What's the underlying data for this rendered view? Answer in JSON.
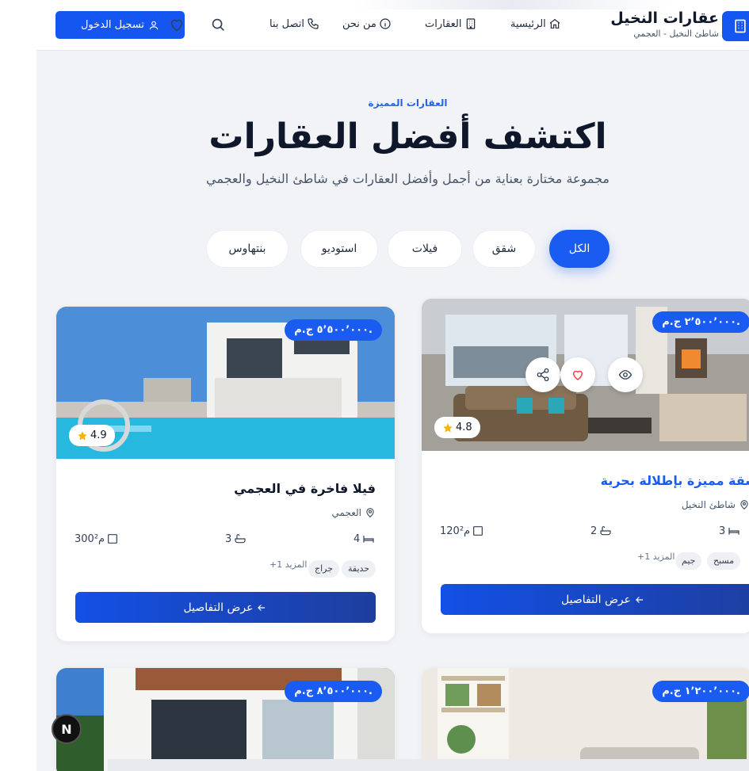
{
  "header": {
    "brand_name": "عقارات النخيل",
    "brand_sub": "شاطئ النخيل - العجمي",
    "login_label": "تسجيل الدخول",
    "nav": [
      {
        "label": "الرئيسية",
        "icon": "home-icon"
      },
      {
        "label": "العقارات",
        "icon": "building-icon"
      },
      {
        "label": "من نحن",
        "icon": "info-icon"
      },
      {
        "label": "اتصل بنا",
        "icon": "phone-icon"
      }
    ],
    "icons": [
      "search-icon",
      "heart-icon",
      "user-icon"
    ]
  },
  "hero": {
    "eyebrow": "العقارات المميزة",
    "title": "اكتشف أفضل العقارات",
    "subtitle": "مجموعة مختارة بعناية من أجمل وأفضل العقارات في شاطئ النخيل والعجمي"
  },
  "filters": [
    {
      "label": "الكل",
      "active": true
    },
    {
      "label": "شقق",
      "active": false
    },
    {
      "label": "فيلات",
      "active": false
    },
    {
      "label": "استوديو",
      "active": false
    },
    {
      "label": "بنتهاوس",
      "active": false
    }
  ],
  "cards": [
    {
      "price": "٢٬٥٠٠٬٠٠٠ ج.م.",
      "rating": "4.8",
      "title": "شقة مميزة بإطلالة بحرية",
      "location": "شاطئ النخيل",
      "beds": "3",
      "baths": "2",
      "area": "120م²",
      "tags": [
        "مسبح",
        "جيم"
      ],
      "more": "+1 المزيد",
      "details_label": "عرض التفاصيل",
      "hovered": true
    },
    {
      "price": "٥٬٥٠٠٬٠٠٠ ج.م.",
      "rating": "4.9",
      "title": "فيلا فاخرة في العجمي",
      "location": "العجمي",
      "beds": "4",
      "baths": "3",
      "area": "300م²",
      "tags": [
        "حديقة",
        "جراج"
      ],
      "more": "+1 المزيد",
      "details_label": "عرض التفاصيل",
      "hovered": false
    },
    {
      "price": "١٬٢٠٠٬٠٠٠ ج.م."
    },
    {
      "price": "٨٬٥٠٠٬٠٠٠ ج.م."
    }
  ],
  "badge": "N",
  "colors": {
    "accent": "#1a5cf2",
    "star": "#f5b400",
    "heart": "#ef4444"
  }
}
